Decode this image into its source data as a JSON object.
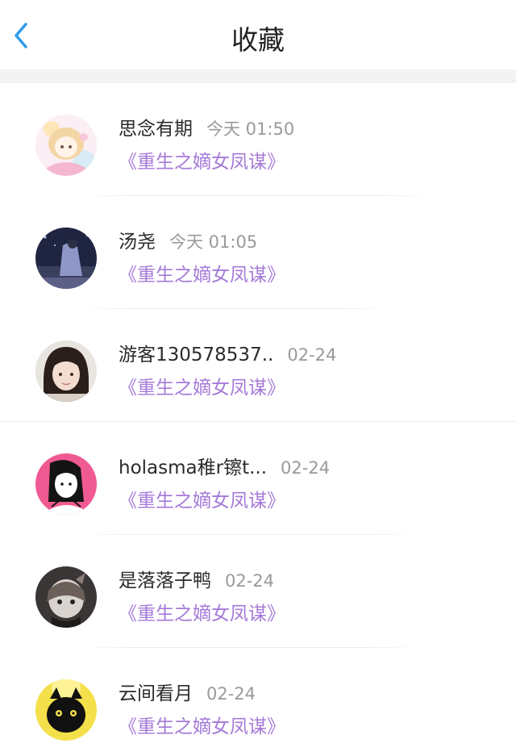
{
  "header": {
    "title": "收藏",
    "back_icon": "chevron-left-icon",
    "accent_color": "#2e9cea"
  },
  "list": {
    "items": [
      {
        "name": "思念有期",
        "time": "今天 01:50",
        "book": "《重生之嫡女凤谋》",
        "avatar": "anime-girl-avatar"
      },
      {
        "name": "汤尧",
        "time": "今天 01:05",
        "book": "《重生之嫡女凤谋》",
        "avatar": "night-photo-avatar"
      },
      {
        "name": "游客130578537..",
        "time": "02-24",
        "book": "《重生之嫡女凤谋》",
        "avatar": "girl-photo-avatar"
      },
      {
        "name": "holasma稚r镲t...",
        "time": "02-24",
        "book": "《重生之嫡女凤谋》",
        "avatar": "pink-illustration-avatar"
      },
      {
        "name": "是落落子鸭",
        "time": "02-24",
        "book": "《重生之嫡女凤谋》",
        "avatar": "dark-figure-avatar"
      },
      {
        "name": "云间看月",
        "time": "02-24",
        "book": "《重生之嫡女凤谋》",
        "avatar": "black-cat-avatar"
      }
    ],
    "book_color": "#a57ad8",
    "time_color": "#9a9a9a"
  }
}
